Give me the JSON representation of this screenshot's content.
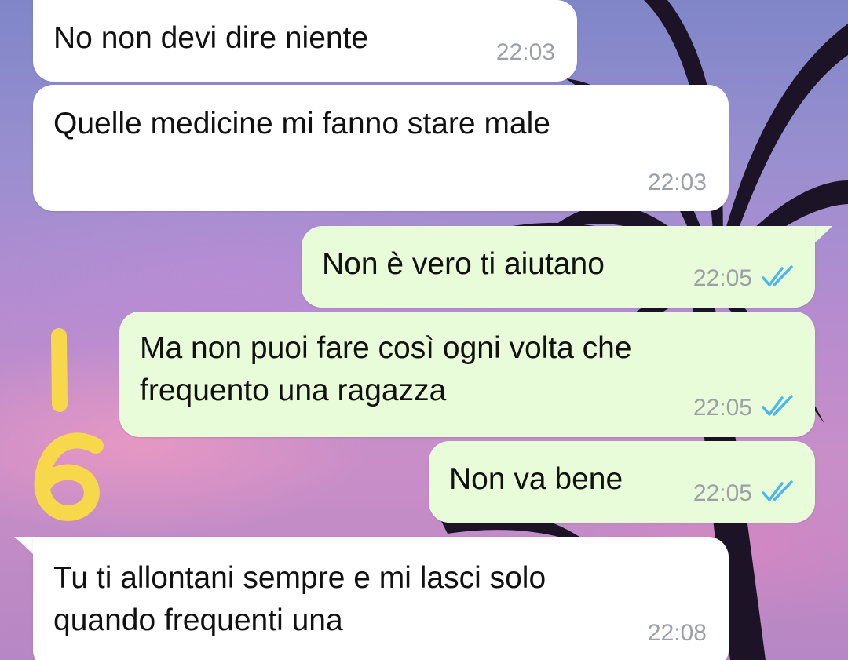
{
  "messages": [
    {
      "direction": "incoming",
      "text": "No non devi dire niente",
      "time": "22:03"
    },
    {
      "direction": "incoming",
      "text": "Quelle medicine mi fanno stare male",
      "time": "22:03"
    },
    {
      "direction": "outgoing",
      "text": "Non è vero ti aiutano",
      "time": "22:05",
      "status": "read-double-check-icon"
    },
    {
      "direction": "outgoing",
      "text": "Ma non puoi fare così ogni volta che\nfrequento una ragazza",
      "time": "22:05",
      "status": "read-double-check-icon"
    },
    {
      "direction": "outgoing",
      "text": "Non va bene",
      "time": "22:05",
      "status": "read-double-check-icon"
    },
    {
      "direction": "incoming",
      "text": "Tu ti allontani sempre e mi lasci solo\nquando frequenti una",
      "time": "22:08"
    }
  ],
  "annotation": {
    "text": "16",
    "color": "#f7d84a"
  },
  "colors": {
    "incoming_bubble": "#ffffff",
    "outgoing_bubble": "#e9fcd9",
    "read_ticks": "#4fb6ec",
    "timestamp": "#9aa0a6"
  }
}
